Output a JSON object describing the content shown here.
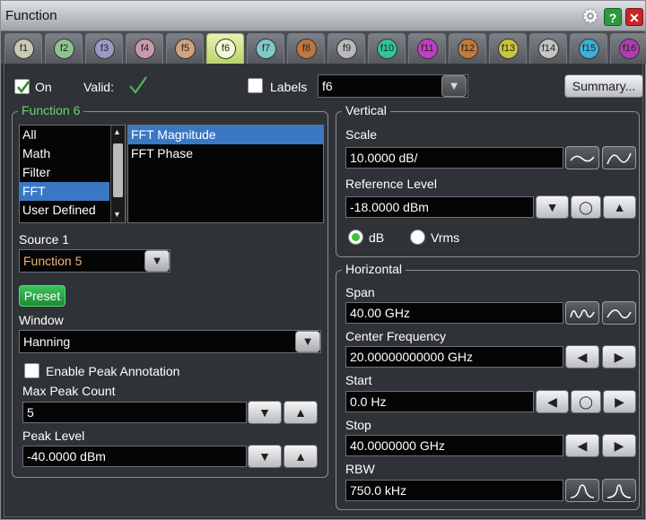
{
  "window": {
    "title": "Function"
  },
  "tabs": [
    {
      "label": "f1",
      "color": "#c7c9b0"
    },
    {
      "label": "f2",
      "color": "#8cc48e"
    },
    {
      "label": "f3",
      "color": "#9a9ac8"
    },
    {
      "label": "f4",
      "color": "#c89aa8"
    },
    {
      "label": "f5",
      "color": "#d0a37c"
    },
    {
      "label": "f6",
      "color": "#d6ea8a"
    },
    {
      "label": "f7",
      "color": "#7ec8c8"
    },
    {
      "label": "f8",
      "color": "#c2763c"
    },
    {
      "label": "f9",
      "color": "#b9b9b9"
    },
    {
      "label": "f10",
      "color": "#2ec59a"
    },
    {
      "label": "f11",
      "color": "#c23cc8"
    },
    {
      "label": "f12",
      "color": "#c27a3c"
    },
    {
      "label": "f13",
      "color": "#c8c43c"
    },
    {
      "label": "f14",
      "color": "#c4c4c4"
    },
    {
      "label": "f15",
      "color": "#3cb0d8"
    },
    {
      "label": "f16",
      "color": "#b43cb0"
    }
  ],
  "top": {
    "on_label": "On",
    "valid_label": "Valid:",
    "labels_label": "Labels",
    "labels_value": "f6",
    "summary_label": "Summary..."
  },
  "function": {
    "group_title": "Function 6",
    "categories": [
      "All",
      "Math",
      "Filter",
      "FFT",
      "User Defined"
    ],
    "selected_category": "FFT",
    "operators": [
      "FFT Magnitude",
      "FFT Phase"
    ],
    "selected_operator": "FFT Magnitude",
    "source_label": "Source 1",
    "source_value": "Function 5",
    "preset_label": "Preset",
    "window_label": "Window",
    "window_value": "Hanning",
    "peak_annotation_label": "Enable Peak Annotation",
    "max_peak_label": "Max Peak Count",
    "max_peak_value": "5",
    "peak_level_label": "Peak Level",
    "peak_level_value": "-40.0000 dBm"
  },
  "vertical": {
    "group_title": "Vertical",
    "scale_label": "Scale",
    "scale_value": "10.0000 dB/",
    "ref_label": "Reference Level",
    "ref_value": "-18.0000 dBm",
    "db_label": "dB",
    "vrms_label": "Vrms"
  },
  "horizontal": {
    "group_title": "Horizontal",
    "span_label": "Span",
    "span_value": "40.00 GHz",
    "center_label": "Center Frequency",
    "center_value": "20.00000000000 GHz",
    "start_label": "Start",
    "start_value": "0.0 Hz",
    "stop_label": "Stop",
    "stop_value": "40.0000000 GHz",
    "rbw_label": "RBW",
    "rbw_value": "750.0 kHz"
  },
  "colors": {
    "accent_green": "#6fd36f",
    "selection_blue": "#3a78c4",
    "source_text": "#f0b27a"
  }
}
